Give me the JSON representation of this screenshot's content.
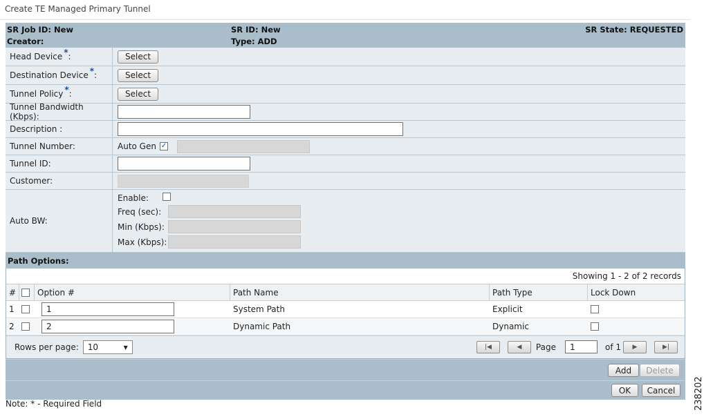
{
  "page": {
    "title": "Create TE Managed Primary Tunnel",
    "figure_id": "238202"
  },
  "sr": {
    "job_id": "SR Job ID: New",
    "creator": "Creator:",
    "sr_id": "SR ID: New",
    "type": "Type: ADD",
    "state": "SR State: REQUESTED"
  },
  "form": {
    "required_mark": "*",
    "head_device_label": "Head Device",
    "head_device_suffix": ":",
    "destination_device_label": "Destination Device",
    "destination_device_suffix": ":",
    "tunnel_policy_label": "Tunnel Policy",
    "tunnel_policy_suffix": ":",
    "select_label": "Select",
    "bandwidth_label": "Tunnel Bandwidth (Kbps):",
    "bandwidth_value": "",
    "description_label": "Description :",
    "description_value": "",
    "tunnel_number_label": "Tunnel Number:",
    "auto_gen_label": "Auto Gen",
    "auto_gen_checked": true,
    "tunnel_id_label": "Tunnel ID:",
    "tunnel_id_value": "",
    "customer_label": "Customer:",
    "auto_bw": {
      "label": "Auto BW:",
      "enable_label": "Enable:",
      "enable_checked": false,
      "freq_label": "Freq (sec):",
      "min_label": "Min (Kbps):",
      "max_label": "Max (Kbps):"
    }
  },
  "path_options": {
    "section_label": "Path Options:",
    "showing_text": "Showing 1 - 2 of 2 records",
    "columns": [
      "#",
      "Option #",
      "Path Name",
      "Path Type",
      "Lock Down"
    ],
    "rows": [
      {
        "index": "1",
        "option": "1",
        "path_name": "System Path",
        "path_type": "Explicit",
        "lock_down": false
      },
      {
        "index": "2",
        "option": "2",
        "path_name": "Dynamic Path",
        "path_type": "Dynamic",
        "lock_down": false
      }
    ],
    "pager": {
      "rows_per_page_label": "Rows per page:",
      "rows_per_page_value": "10",
      "page_label": "Page",
      "page_value": "1",
      "of_label": "of 1"
    }
  },
  "actions": {
    "add": "Add",
    "delete": "Delete",
    "ok": "OK",
    "cancel": "Cancel"
  },
  "note": {
    "text": "Note: * - Required Field"
  },
  "icons": {
    "check": "check-icon",
    "first": "first-page-icon",
    "prev": "prev-page-icon",
    "next": "next-page-icon",
    "last": "last-page-icon",
    "dropdown": "chevron-down-icon"
  }
}
